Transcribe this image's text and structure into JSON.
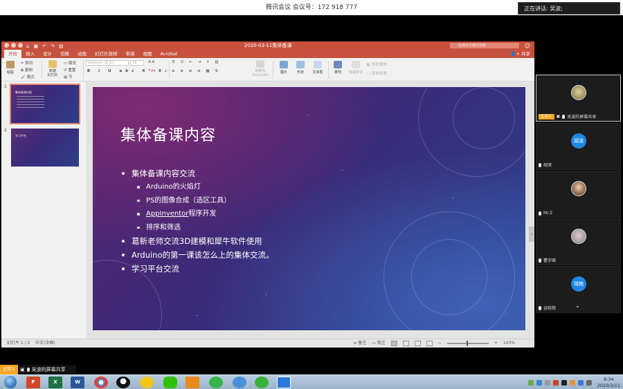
{
  "meeting": {
    "top_title": "腾讯会议  会议号：172 918 777",
    "speaking": "正在讲话: 吴波;"
  },
  "ppt": {
    "doc_title": "2020-03-11集体备课",
    "search_placeholder": "在演示文稿中搜索",
    "tabs": [
      "开始",
      "插入",
      "设计",
      "切换",
      "动画",
      "幻灯片放映",
      "审阅",
      "视图",
      "Acrobat"
    ],
    "active_tab": "开始",
    "share_label": "共享",
    "ribbon": {
      "paste": "粘贴",
      "cut": "剪切",
      "copy": "复制",
      "format": "格式",
      "new_slide": "新建\n幻灯片",
      "layout": "版式",
      "reset": "重置",
      "section": "节",
      "font_name": "Gentium (正文)",
      "font_size": "18",
      "convert_smartart": "转换为\nSmartArt",
      "picture": "图片",
      "shape": "形状",
      "textbox": "文本框",
      "arrange": "排列",
      "quick_styles": "快速样式",
      "shape_fill": "形状填充",
      "shape_outline": "形状轮廓"
    },
    "thumbnails": [
      {
        "number": "1",
        "title": "集体备课内容"
      },
      {
        "number": "2",
        "title": "学习平台"
      }
    ],
    "slide": {
      "title": "集体备课内容",
      "bullets": [
        {
          "level": 1,
          "text": "集体备课内容交流"
        },
        {
          "level": 2,
          "text": "Arduino的火焰灯"
        },
        {
          "level": 2,
          "text": "PS的图像合成（选区工具）"
        },
        {
          "level": 2,
          "text_underlined": "AppInventor",
          "text": "程序开发"
        },
        {
          "level": 2,
          "text": "排序和筛选"
        },
        {
          "level": 1,
          "text": "葛新老师交流3D建模和犀牛软件使用"
        },
        {
          "level": 1,
          "text": "Arduino的第一课该怎么上的集体交流。"
        },
        {
          "level": 1,
          "text": "学习平台交流"
        }
      ]
    },
    "status": {
      "slide_count": "幻灯片 1 / 2",
      "language": "中文(中国)",
      "notes": "备注",
      "comments": "批注",
      "zoom": "143%"
    }
  },
  "participants": [
    {
      "name": "吴波的屏幕共享",
      "host_label": "主持人",
      "avatar": "image",
      "avatar_text": ""
    },
    {
      "name": "胡滨",
      "avatar": "blue",
      "avatar_text": "胡滨"
    },
    {
      "name": "Mr.Z",
      "avatar": "image",
      "avatar_text": ""
    },
    {
      "name": "曹宇卿",
      "avatar": "image",
      "avatar_text": ""
    },
    {
      "name": "谷晓艳",
      "avatar": "blue",
      "avatar_text": "晓艳"
    }
  ],
  "share_bar": {
    "host_label": "主持人",
    "text": "吴波的屏幕共享"
  },
  "taskbar": {
    "apps": [
      "P",
      "X",
      "W"
    ],
    "time": "9:34",
    "date": "2020/3/11"
  },
  "colors": {
    "ppt_accent": "#c7513e",
    "host_badge": "#f5a623",
    "avatar_blue": "#1e88e5"
  }
}
